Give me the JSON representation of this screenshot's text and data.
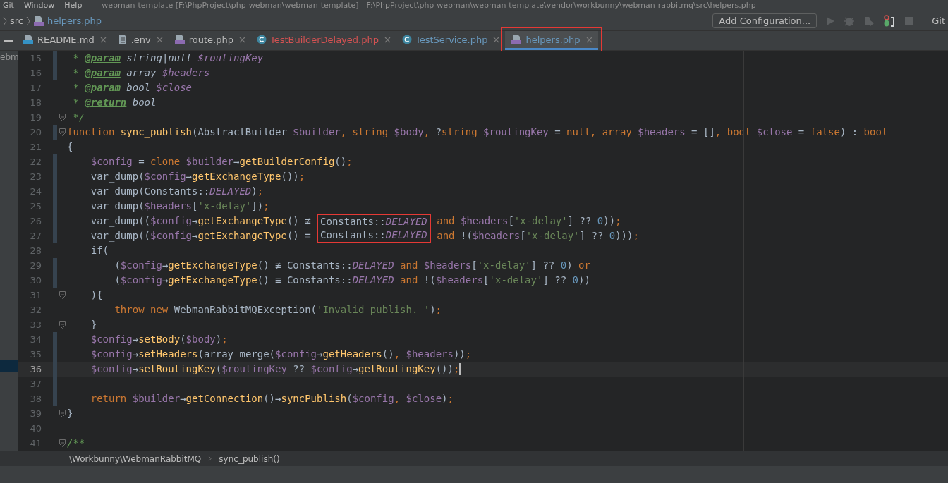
{
  "menu": {
    "items": [
      "Git",
      "Window",
      "Help"
    ],
    "title": "webman-template [F:\\PhpProject\\php-webman\\webman-template] - F:\\PhpProject\\php-webman\\webman-template\\vendor\\workbunny\\webman-rabbitmq\\src\\helpers.php"
  },
  "navbar": {
    "breadcrumb": [
      "src",
      "helpers.php"
    ],
    "config_button": "Add Configuration...",
    "vcs_label": "Git"
  },
  "tabs": [
    {
      "label": "README.md",
      "kind": "md",
      "color": "#bbbbbb",
      "selected": false,
      "boxed": false
    },
    {
      "label": ".env",
      "kind": "text",
      "color": "#bbbbbb",
      "selected": false,
      "boxed": false
    },
    {
      "label": "route.php",
      "kind": "php",
      "color": "#bbbbbb",
      "selected": false,
      "boxed": false
    },
    {
      "label": "TestBuilderDelayed.php",
      "kind": "class",
      "color": "#d25252",
      "selected": false,
      "boxed": false
    },
    {
      "label": "TestService.php",
      "kind": "class",
      "color": "#6897bb",
      "selected": false,
      "boxed": false
    },
    {
      "label": "helpers.php",
      "kind": "php",
      "color": "#6897bb",
      "selected": true,
      "boxed": true
    }
  ],
  "project_strip": {
    "text": "ebm"
  },
  "editor": {
    "lines": [
      {
        "number": "15",
        "changed": true,
        "fold": false,
        "current": false,
        "tokens": [
          {
            "kind": "doc",
            "text": " * "
          },
          {
            "kind": "tag",
            "text": "@param"
          },
          {
            "kind": "dtype",
            "text": " string|null "
          },
          {
            "kind": "dvar",
            "text": "$routingKey"
          }
        ]
      },
      {
        "number": "16",
        "changed": true,
        "fold": false,
        "current": false,
        "tokens": [
          {
            "kind": "doc",
            "text": " * "
          },
          {
            "kind": "tag",
            "text": "@param"
          },
          {
            "kind": "dtype",
            "text": " array "
          },
          {
            "kind": "dvar",
            "text": "$headers"
          }
        ]
      },
      {
        "number": "17",
        "changed": false,
        "fold": false,
        "current": false,
        "tokens": [
          {
            "kind": "doc",
            "text": " * "
          },
          {
            "kind": "tag",
            "text": "@param"
          },
          {
            "kind": "dtype",
            "text": " bool "
          },
          {
            "kind": "dvar",
            "text": "$close"
          }
        ]
      },
      {
        "number": "18",
        "changed": false,
        "fold": false,
        "current": false,
        "tokens": [
          {
            "kind": "doc",
            "text": " * "
          },
          {
            "kind": "tag",
            "text": "@return"
          },
          {
            "kind": "dtype",
            "text": " bool"
          }
        ]
      },
      {
        "number": "19",
        "changed": false,
        "fold": true,
        "current": false,
        "tokens": [
          {
            "kind": "doc",
            "text": " */"
          }
        ]
      },
      {
        "number": "20",
        "changed": true,
        "fold": true,
        "current": false,
        "tokens": [
          {
            "kind": "kw",
            "text": "function "
          },
          {
            "kind": "fn",
            "text": "sync_publish"
          },
          {
            "kind": "plain",
            "text": "(AbstractBuilder "
          },
          {
            "kind": "var",
            "text": "$builder"
          },
          {
            "kind": "kw",
            "text": ", string "
          },
          {
            "kind": "var",
            "text": "$body"
          },
          {
            "kind": "kw",
            "text": ", "
          },
          {
            "kind": "plain",
            "text": "?"
          },
          {
            "kind": "kw",
            "text": "string "
          },
          {
            "kind": "var",
            "text": "$routingKey"
          },
          {
            "kind": "plain",
            "text": " = "
          },
          {
            "kind": "kw",
            "text": "null, array "
          },
          {
            "kind": "var",
            "text": "$headers"
          },
          {
            "kind": "plain",
            "text": " = []"
          },
          {
            "kind": "kw",
            "text": ", bool "
          },
          {
            "kind": "var",
            "text": "$close"
          },
          {
            "kind": "plain",
            "text": " = "
          },
          {
            "kind": "kw",
            "text": "false"
          },
          {
            "kind": "plain",
            "text": ") : "
          },
          {
            "kind": "kw",
            "text": "bool"
          }
        ]
      },
      {
        "number": "21",
        "changed": false,
        "fold": false,
        "current": false,
        "tokens": [
          {
            "kind": "plain",
            "text": "{"
          }
        ]
      },
      {
        "number": "22",
        "changed": true,
        "fold": false,
        "current": false,
        "tokens": [
          {
            "kind": "var",
            "text": "    $config"
          },
          {
            "kind": "plain",
            "text": " = "
          },
          {
            "kind": "kw",
            "text": "clone "
          },
          {
            "kind": "var",
            "text": "$builder"
          },
          {
            "kind": "plain",
            "text": "→"
          },
          {
            "kind": "fn",
            "text": "getBuilderConfig"
          },
          {
            "kind": "plain",
            "text": "()"
          },
          {
            "kind": "kw",
            "text": ";"
          }
        ]
      },
      {
        "number": "23",
        "changed": true,
        "fold": false,
        "current": false,
        "tokens": [
          {
            "kind": "plain",
            "text": "    var_dump("
          },
          {
            "kind": "var",
            "text": "$config"
          },
          {
            "kind": "plain",
            "text": "→"
          },
          {
            "kind": "fn",
            "text": "getExchangeType"
          },
          {
            "kind": "plain",
            "text": "())"
          },
          {
            "kind": "kw",
            "text": ";"
          }
        ]
      },
      {
        "number": "24",
        "changed": true,
        "fold": false,
        "current": false,
        "tokens": [
          {
            "kind": "plain",
            "text": "    var_dump("
          },
          {
            "kind": "static",
            "class": "Constants",
            "sep": "::",
            "member": "DELAYED",
            "boxed": false
          },
          {
            "kind": "plain",
            "text": ")"
          },
          {
            "kind": "kw",
            "text": ";"
          }
        ]
      },
      {
        "number": "25",
        "changed": true,
        "fold": false,
        "current": false,
        "tokens": [
          {
            "kind": "plain",
            "text": "    var_dump("
          },
          {
            "kind": "var",
            "text": "$headers"
          },
          {
            "kind": "plain",
            "text": "["
          },
          {
            "kind": "str",
            "text": "'x-delay'"
          },
          {
            "kind": "plain",
            "text": "])"
          },
          {
            "kind": "kw",
            "text": ";"
          }
        ]
      },
      {
        "number": "26",
        "changed": true,
        "fold": false,
        "current": false,
        "tokens": [
          {
            "kind": "plain",
            "text": "    var_dump(("
          },
          {
            "kind": "var",
            "text": "$config"
          },
          {
            "kind": "plain",
            "text": "→"
          },
          {
            "kind": "fn",
            "text": "getExchangeType"
          },
          {
            "kind": "plain",
            "text": "() ≢ "
          },
          {
            "kind": "static",
            "class": "Constants",
            "sep": "::",
            "member": "DELAYED",
            "boxed": true
          },
          {
            "kind": "kw",
            "text": " and "
          },
          {
            "kind": "var",
            "text": "$headers"
          },
          {
            "kind": "plain",
            "text": "["
          },
          {
            "kind": "str",
            "text": "'x-delay'"
          },
          {
            "kind": "plain",
            "text": "] ?? "
          },
          {
            "kind": "num",
            "text": "0"
          },
          {
            "kind": "plain",
            "text": "))"
          },
          {
            "kind": "kw",
            "text": ";"
          }
        ]
      },
      {
        "number": "27",
        "changed": true,
        "fold": false,
        "current": false,
        "tokens": [
          {
            "kind": "plain",
            "text": "    var_dump(("
          },
          {
            "kind": "var",
            "text": "$config"
          },
          {
            "kind": "plain",
            "text": "→"
          },
          {
            "kind": "fn",
            "text": "getExchangeType"
          },
          {
            "kind": "plain",
            "text": "() ≡ "
          },
          {
            "kind": "static",
            "class": "Constants",
            "sep": "::",
            "member": "DELAYED",
            "boxed": true
          },
          {
            "kind": "kw",
            "text": " and "
          },
          {
            "kind": "plain",
            "text": "!("
          },
          {
            "kind": "var",
            "text": "$headers"
          },
          {
            "kind": "plain",
            "text": "["
          },
          {
            "kind": "str",
            "text": "'x-delay'"
          },
          {
            "kind": "plain",
            "text": "] ?? "
          },
          {
            "kind": "num",
            "text": "0"
          },
          {
            "kind": "plain",
            "text": ")))"
          },
          {
            "kind": "kw",
            "text": ";"
          }
        ]
      },
      {
        "number": "28",
        "changed": false,
        "fold": false,
        "current": false,
        "tokens": [
          {
            "kind": "plain",
            "text": "    if("
          }
        ]
      },
      {
        "number": "29",
        "changed": true,
        "fold": false,
        "current": false,
        "tokens": [
          {
            "kind": "plain",
            "text": "        ("
          },
          {
            "kind": "var",
            "text": "$config"
          },
          {
            "kind": "plain",
            "text": "→"
          },
          {
            "kind": "fn",
            "text": "getExchangeType"
          },
          {
            "kind": "plain",
            "text": "() ≢ "
          },
          {
            "kind": "static",
            "class": "Constants",
            "sep": "::",
            "member": "DELAYED",
            "boxed": false
          },
          {
            "kind": "kw",
            "text": " and "
          },
          {
            "kind": "var",
            "text": "$headers"
          },
          {
            "kind": "plain",
            "text": "["
          },
          {
            "kind": "str",
            "text": "'x-delay'"
          },
          {
            "kind": "plain",
            "text": "] ?? "
          },
          {
            "kind": "num",
            "text": "0"
          },
          {
            "kind": "plain",
            "text": ") "
          },
          {
            "kind": "kw",
            "text": "or"
          }
        ]
      },
      {
        "number": "30",
        "changed": true,
        "fold": false,
        "current": false,
        "tokens": [
          {
            "kind": "plain",
            "text": "        ("
          },
          {
            "kind": "var",
            "text": "$config"
          },
          {
            "kind": "plain",
            "text": "→"
          },
          {
            "kind": "fn",
            "text": "getExchangeType"
          },
          {
            "kind": "plain",
            "text": "() ≡ "
          },
          {
            "kind": "static",
            "class": "Constants",
            "sep": "::",
            "member": "DELAYED",
            "boxed": false
          },
          {
            "kind": "kw",
            "text": " and "
          },
          {
            "kind": "plain",
            "text": "!("
          },
          {
            "kind": "var",
            "text": "$headers"
          },
          {
            "kind": "plain",
            "text": "["
          },
          {
            "kind": "str",
            "text": "'x-delay'"
          },
          {
            "kind": "plain",
            "text": "] ?? "
          },
          {
            "kind": "num",
            "text": "0"
          },
          {
            "kind": "plain",
            "text": "))"
          }
        ]
      },
      {
        "number": "31",
        "changed": false,
        "fold": true,
        "current": false,
        "tokens": [
          {
            "kind": "plain",
            "text": "    ){"
          }
        ]
      },
      {
        "number": "32",
        "changed": false,
        "fold": false,
        "current": false,
        "tokens": [
          {
            "kind": "kw",
            "text": "        throw new "
          },
          {
            "kind": "plain",
            "text": "WebmanRabbitMQException("
          },
          {
            "kind": "str",
            "text": "'Invalid publish. '"
          },
          {
            "kind": "plain",
            "text": ")"
          },
          {
            "kind": "kw",
            "text": ";"
          }
        ]
      },
      {
        "number": "33",
        "changed": false,
        "fold": true,
        "current": false,
        "tokens": [
          {
            "kind": "plain",
            "text": "    }"
          }
        ]
      },
      {
        "number": "34",
        "changed": true,
        "fold": false,
        "current": false,
        "tokens": [
          {
            "kind": "var",
            "text": "    $config"
          },
          {
            "kind": "plain",
            "text": "→"
          },
          {
            "kind": "fn",
            "text": "setBody"
          },
          {
            "kind": "plain",
            "text": "("
          },
          {
            "kind": "var",
            "text": "$body"
          },
          {
            "kind": "plain",
            "text": ")"
          },
          {
            "kind": "kw",
            "text": ";"
          }
        ]
      },
      {
        "number": "35",
        "changed": true,
        "fold": false,
        "current": false,
        "tokens": [
          {
            "kind": "var",
            "text": "    $config"
          },
          {
            "kind": "plain",
            "text": "→"
          },
          {
            "kind": "fn",
            "text": "setHeaders"
          },
          {
            "kind": "plain",
            "text": "(array_merge("
          },
          {
            "kind": "var",
            "text": "$config"
          },
          {
            "kind": "plain",
            "text": "→"
          },
          {
            "kind": "fn",
            "text": "getHeaders"
          },
          {
            "kind": "plain",
            "text": "()"
          },
          {
            "kind": "kw",
            "text": ", "
          },
          {
            "kind": "var",
            "text": "$headers"
          },
          {
            "kind": "plain",
            "text": "))"
          },
          {
            "kind": "kw",
            "text": ";"
          }
        ]
      },
      {
        "number": "36",
        "changed": true,
        "fold": false,
        "current": true,
        "tokens": [
          {
            "kind": "var",
            "text": "    $config"
          },
          {
            "kind": "plain",
            "text": "→"
          },
          {
            "kind": "fn",
            "text": "setRoutingKey"
          },
          {
            "kind": "plain",
            "text": "("
          },
          {
            "kind": "var",
            "text": "$routingKey"
          },
          {
            "kind": "plain",
            "text": " ?? "
          },
          {
            "kind": "var",
            "text": "$config"
          },
          {
            "kind": "plain",
            "text": "→"
          },
          {
            "kind": "fn",
            "text": "getRoutingKey"
          },
          {
            "kind": "plain",
            "text": "())"
          },
          {
            "kind": "kw",
            "text": ";"
          }
        ]
      },
      {
        "number": "37",
        "changed": true,
        "fold": false,
        "current": false
      },
      {
        "number": "38",
        "changed": true,
        "fold": false,
        "current": false,
        "tokens": [
          {
            "kind": "kw",
            "text": "    return "
          },
          {
            "kind": "var",
            "text": "$builder"
          },
          {
            "kind": "plain",
            "text": "→"
          },
          {
            "kind": "fn",
            "text": "getConnection"
          },
          {
            "kind": "plain",
            "text": "()→"
          },
          {
            "kind": "fn",
            "text": "syncPublish"
          },
          {
            "kind": "plain",
            "text": "("
          },
          {
            "kind": "var",
            "text": "$config"
          },
          {
            "kind": "kw",
            "text": ", "
          },
          {
            "kind": "var",
            "text": "$close"
          },
          {
            "kind": "plain",
            "text": ")"
          },
          {
            "kind": "kw",
            "text": ";"
          }
        ]
      },
      {
        "number": "39",
        "changed": false,
        "fold": true,
        "current": false,
        "tokens": [
          {
            "kind": "plain",
            "text": "}"
          }
        ]
      },
      {
        "number": "40",
        "changed": false,
        "fold": false,
        "current": false
      },
      {
        "number": "41",
        "changed": false,
        "fold": true,
        "current": false,
        "tokens": [
          {
            "kind": "doc",
            "text": "/**"
          }
        ]
      }
    ]
  },
  "breadcrumb": [
    "\\Workbunny\\WebmanRabbitMQ",
    "sync_publish()"
  ]
}
